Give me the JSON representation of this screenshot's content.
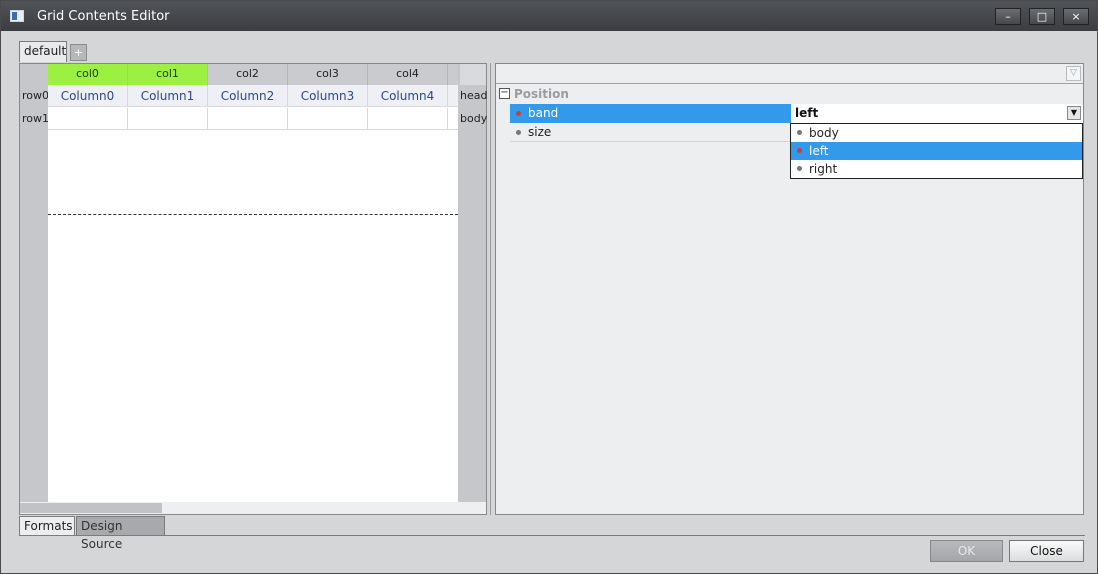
{
  "window": {
    "title": "Grid Contents Editor",
    "controls": {
      "minimize": "–",
      "maximize": "□",
      "close": "×"
    }
  },
  "format_tabs": {
    "default_label": "default",
    "add_label": "+"
  },
  "grid": {
    "columns": [
      "col0",
      "col1",
      "col2",
      "col3",
      "col4"
    ],
    "selected_columns": [
      "col0",
      "col1"
    ],
    "rows": [
      {
        "label": "row0",
        "band": "head",
        "cells": [
          "Column0",
          "Column1",
          "Column2",
          "Column3",
          "Column4"
        ]
      },
      {
        "label": "row1",
        "band": "body",
        "cells": [
          "",
          "",
          "",
          "",
          ""
        ]
      }
    ]
  },
  "properties": {
    "category": "Position",
    "category_toggle": "⊟",
    "items": [
      {
        "name": "band",
        "value": "left",
        "selected": true
      },
      {
        "name": "size",
        "value": "",
        "selected": false
      }
    ],
    "dropdown_options": [
      "body",
      "left",
      "right"
    ],
    "dropdown_selected": "left"
  },
  "bottom_tabs": {
    "formats": "Formats",
    "design_source": "Design Source"
  },
  "buttons": {
    "ok": "OK",
    "close": "Close"
  },
  "colors": {
    "selection_blue": "#3399ea",
    "column_highlight": "#9cf041"
  }
}
